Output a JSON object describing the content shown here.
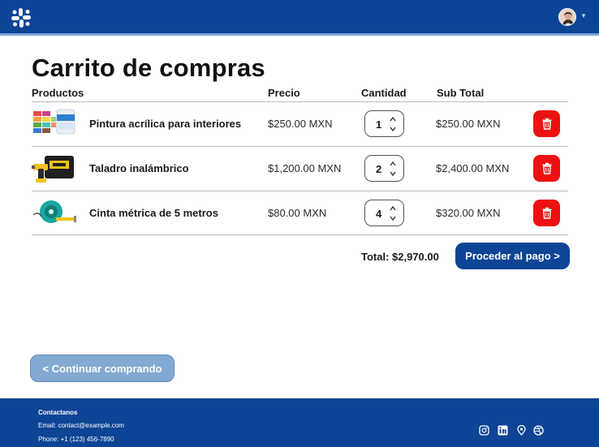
{
  "header": {
    "logo_icon": "slack-like-logo-icon",
    "avatar_icon": "user-avatar",
    "colors": {
      "bar": "#0d4495",
      "accent_line": "#7ea6d8"
    }
  },
  "page": {
    "title": "Carrito de compras"
  },
  "table": {
    "headers": {
      "products": "Productos",
      "price": "Precio",
      "quantity": "Cantidad",
      "subtotal": "Sub Total"
    },
    "rows": [
      {
        "name": "Pintura acrílica para interiores",
        "price": "$250.00 MXN",
        "quantity": "1",
        "subtotal": "$250.00 MXN",
        "thumb_icon": "paint-samples-image"
      },
      {
        "name": "Taladro inalámbrico",
        "price": "$1,200.00 MXN",
        "quantity": "2",
        "subtotal": "$2,400.00 MXN",
        "thumb_icon": "cordless-drill-image"
      },
      {
        "name": "Cinta métrica de 5 metros",
        "price": "$80.00 MXN",
        "quantity": "4",
        "subtotal": "$320.00 MXN",
        "thumb_icon": "tape-measure-image"
      }
    ]
  },
  "summary": {
    "total": "Total: $2,970.00",
    "checkout_label": "Proceder al pago >"
  },
  "continue_label": "< Continuar comprando",
  "footer": {
    "title": "Contactanos",
    "email": "Email: contact@example.com",
    "phone": "Phone: +1 (123) 456-7890",
    "social_icons": [
      "instagram-icon",
      "linkedin-icon",
      "location-icon",
      "dribbble-icon"
    ]
  },
  "colors": {
    "primary": "#0d4495",
    "delete": "#ee1111",
    "continue_button": "#82a9d1"
  }
}
